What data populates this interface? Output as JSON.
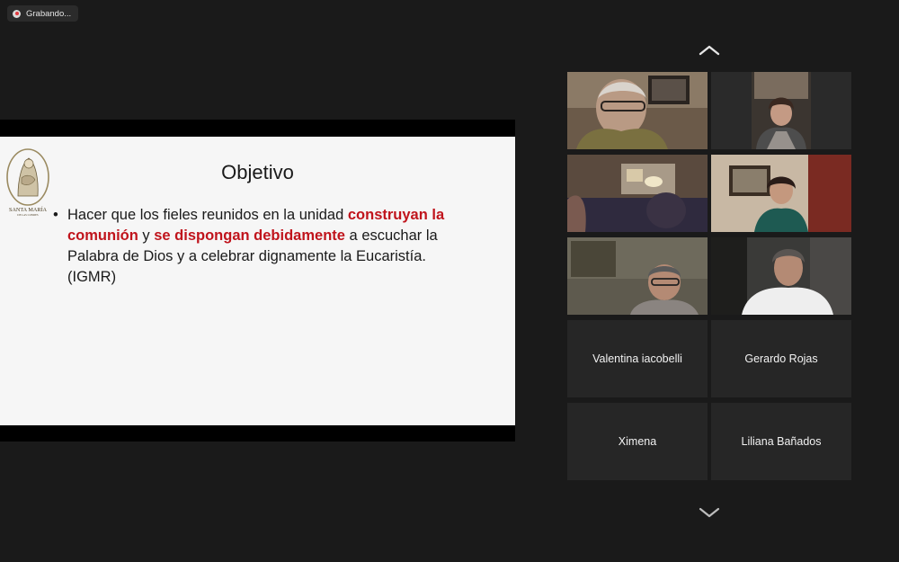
{
  "recording": {
    "label": "Grabando..."
  },
  "slide": {
    "title": "Objetivo",
    "bullet": "•",
    "segments": [
      "Hacer que los fieles reunidos en la unidad ",
      "construyan la comunión",
      " y ",
      "se dispongan debidamente",
      " a escuchar la Palabra de Dios y a celebrar dignamente la Eucaristía. (IGMR)"
    ],
    "logo": {
      "line1": "SANTA MARÍA",
      "line2": "DE LAS CONDES"
    },
    "highlight_color": "#c0141c"
  },
  "gallery": {
    "scroll_up_icon": "chevron-up-icon",
    "scroll_down_icon": "chevron-down-icon",
    "name_tiles": [
      {
        "name": "Valentina iacobelli"
      },
      {
        "name": "Gerardo Rojas"
      },
      {
        "name": "Ximena"
      },
      {
        "name": "Liliana Bañados"
      }
    ]
  }
}
